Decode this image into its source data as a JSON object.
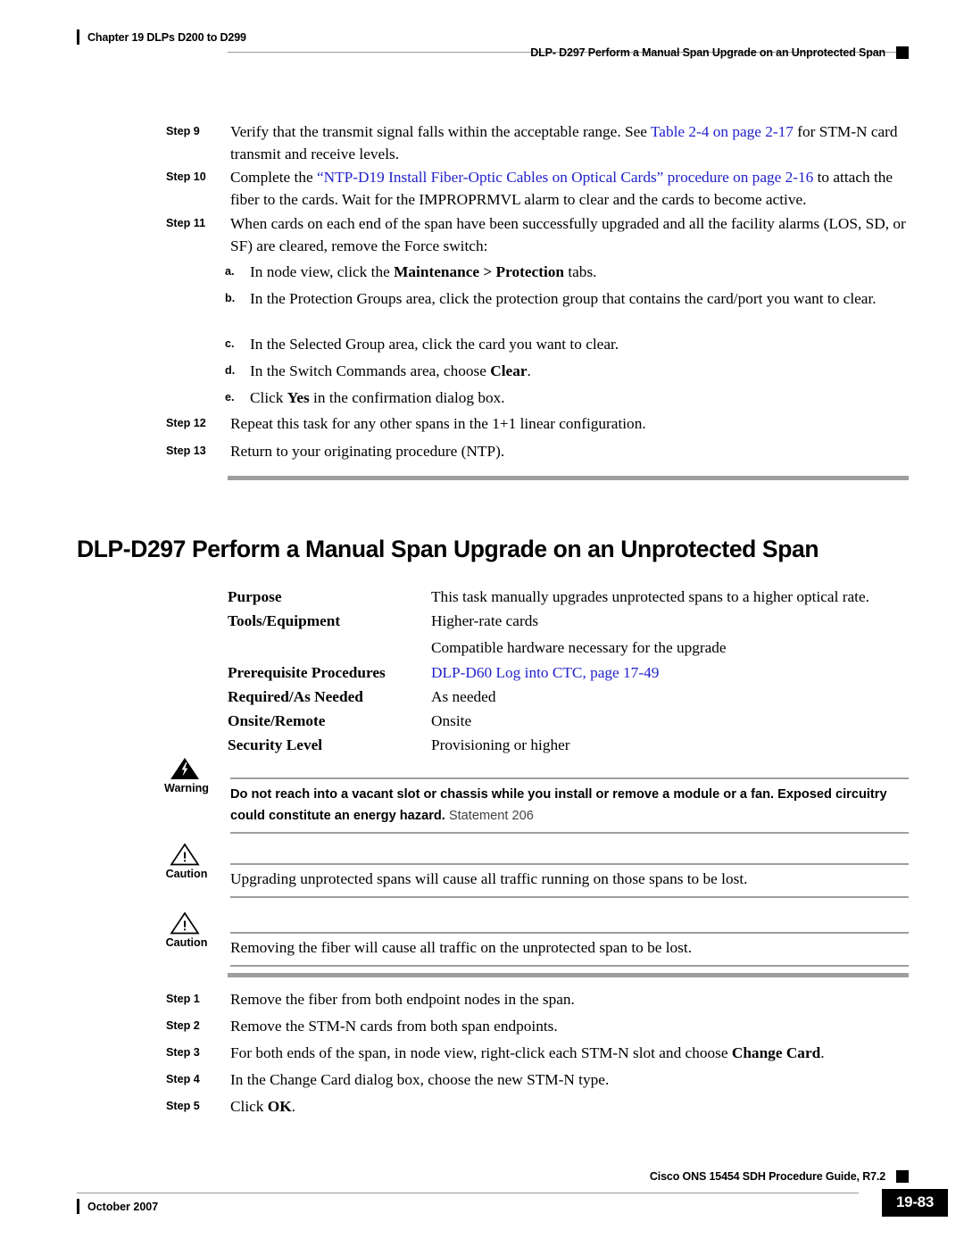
{
  "header": {
    "chapter": "Chapter 19 DLPs D200 to D299",
    "running_title": "DLP- D297 Perform a Manual Span Upgrade on an Unprotected Span"
  },
  "top_steps": [
    {
      "label": "Step 9",
      "text_before": "Verify that the transmit signal falls within the acceptable range. See ",
      "link": "Table 2-4 on page 2-17",
      "text_after": " for STM-N card transmit and receive levels."
    },
    {
      "label": "Step 10",
      "text_before": "Complete the ",
      "link": "“NTP-D19 Install Fiber-Optic Cables on Optical Cards” procedure on page 2-16",
      "text_after": " to attach the fiber to the cards. Wait for the IMPROPRMVL alarm to clear and the cards to become active."
    },
    {
      "label": "Step 11",
      "text": "When cards on each end of the span have been successfully upgraded and all the facility alarms (LOS, SD, or SF) are cleared, remove the Force switch:"
    }
  ],
  "substeps": [
    {
      "label": "a.",
      "pre": "In node view, click the ",
      "bold": "Maintenance > Protection",
      "post": " tabs."
    },
    {
      "label": "b.",
      "pre": "In the Protection Groups area, click the protection group that contains the card/port you want to clear.",
      "bold": "",
      "post": ""
    },
    {
      "label": "c.",
      "pre": "In the Selected Group area, click the card you want to clear.",
      "bold": "",
      "post": ""
    },
    {
      "label": "d.",
      "pre": "In the Switch Commands area, choose ",
      "bold": "Clear",
      "post": "."
    },
    {
      "label": "e.",
      "pre": "Click ",
      "bold": "Yes",
      "post": " in the confirmation dialog box."
    }
  ],
  "top_steps_tail": [
    {
      "label": "Step 12",
      "text": "Repeat this task for any other spans in the 1+1 linear configuration."
    },
    {
      "label": "Step 13",
      "text": "Return to your originating procedure (NTP)."
    }
  ],
  "section": {
    "title": "DLP-D297 Perform a Manual Span Upgrade on an Unprotected Span"
  },
  "properties": [
    {
      "key": "Purpose",
      "value": "This task manually upgrades unprotected spans to a higher optical rate.",
      "is_link": false
    },
    {
      "key": "Tools/Equipment",
      "value": "Higher-rate cards",
      "is_link": false
    },
    {
      "key": "",
      "value": "Compatible hardware necessary for the upgrade",
      "is_link": false
    },
    {
      "key": "Prerequisite Procedures",
      "value": "DLP-D60 Log into CTC, page 17-49",
      "is_link": true
    },
    {
      "key": "Required/As Needed",
      "value": "As needed",
      "is_link": false
    },
    {
      "key": "Onsite/Remote",
      "value": "Onsite",
      "is_link": false
    },
    {
      "key": "Security Level",
      "value": "Provisioning or higher",
      "is_link": false
    }
  ],
  "admonitions": [
    {
      "kind": "warning",
      "label": "Warning",
      "icon": "warning-lightning-triangle-icon",
      "bold_text": "Do not reach into a vacant slot or chassis while you install or remove a module or a fan. Exposed circuitry could constitute an energy hazard.",
      "plain_text": " Statement 206"
    },
    {
      "kind": "caution",
      "label": "Caution",
      "icon": "caution-exclamation-triangle-icon",
      "bold_text": "",
      "plain_text": "Upgrading unprotected spans will cause all traffic running on those spans to be lost."
    },
    {
      "kind": "caution",
      "label": "Caution",
      "icon": "caution-exclamation-triangle-icon",
      "bold_text": "",
      "plain_text": "Removing the fiber will cause all traffic on the unprotected span to be lost."
    }
  ],
  "bottom_steps": [
    {
      "label": "Step 1",
      "pre": "Remove the fiber from both endpoint nodes in the span.",
      "bold": "",
      "post": ""
    },
    {
      "label": "Step 2",
      "pre": "Remove the STM-N cards from both span endpoints.",
      "bold": "",
      "post": ""
    },
    {
      "label": "Step 3",
      "pre": "For both ends of the span, in node view, right-click each STM-N slot and choose ",
      "bold": "Change Card",
      "post": "."
    },
    {
      "label": "Step 4",
      "pre": "In the Change Card dialog box, choose the new STM-N type.",
      "bold": "",
      "post": ""
    },
    {
      "label": "Step 5",
      "pre": "Click ",
      "bold": "OK",
      "post": "."
    }
  ],
  "footer": {
    "guide": "Cisco ONS 15454 SDH Procedure Guide, R7.2",
    "date": "October 2007",
    "page_number": "19-83"
  },
  "colors": {
    "link": "#2222cc",
    "rule": "#9e9e9e",
    "text": "#000000"
  }
}
